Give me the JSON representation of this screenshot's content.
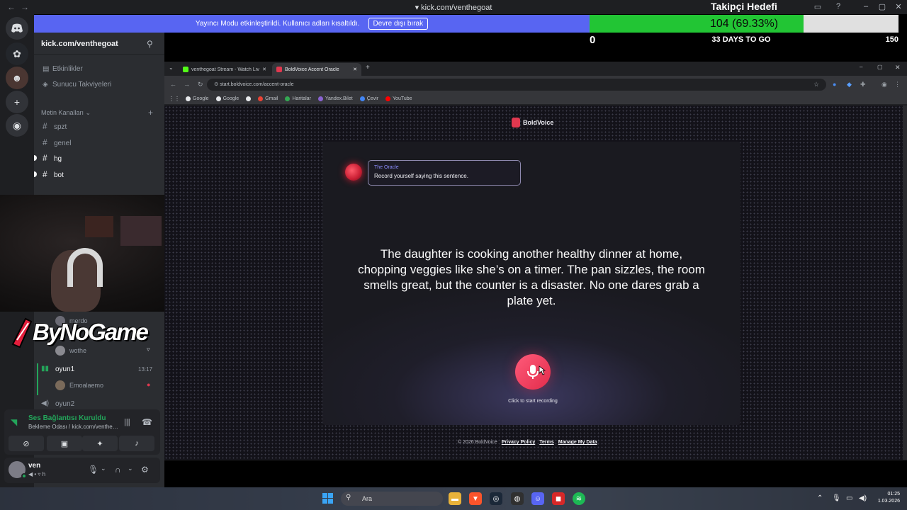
{
  "discord": {
    "window_url": "kick.com/venthegoat",
    "streamer_banner": {
      "text": "Yayıncı Modu etkinleştirildi. Kullanıcı adları kısaltıldı.",
      "button": "Devre dışı bırak"
    },
    "server_name": "kick.com/venthegoat",
    "sidebar_links": [
      {
        "label": "Etkinlikler",
        "icon": "calendar-icon"
      },
      {
        "label": "Sunucu Takviyeleri",
        "icon": "boost-icon"
      }
    ],
    "category_label": "Metin Kanalları",
    "text_channels": [
      "spzt",
      "genel",
      "hg",
      "bot"
    ],
    "voice": {
      "members": [
        "merdo",
        "wothe"
      ],
      "channel1": {
        "name": "oyun1",
        "time": "13:17",
        "member": "Emoalaemo"
      },
      "channel2": {
        "name": "oyun2"
      }
    },
    "voice_panel": {
      "status": "Ses Bağlantısı Kuruldu",
      "sub": "Bekleme Odası / kick.com/venthegoat"
    },
    "user": {
      "name": "ven",
      "sub": "h"
    }
  },
  "overlay": {
    "logo_text": "ByNoGame",
    "goal": {
      "title": "Takipçi Hedefi",
      "count": "104 (69.33%)",
      "progress": 0.6933,
      "min": "0",
      "max": "150",
      "days": "33 DAYS TO GO"
    }
  },
  "browser": {
    "tabs": [
      {
        "title": "venthegoat Stream - Watch Live",
        "color": "#53fc18",
        "active": false
      },
      {
        "title": "BoldVoice Accent Oracle",
        "color": "#e0384f",
        "active": true
      }
    ],
    "url": "start.boldvoice.com/accent-oracle",
    "bookmarks": [
      "Google",
      "Google",
      "",
      "Gmail",
      "Haritalar",
      "Yandex.Bilet",
      "Çevir",
      "YouTube"
    ]
  },
  "boldvoice": {
    "brand": "BoldVoice",
    "oracle_name": "The Oracle",
    "oracle_message": "Record yourself saying this sentence.",
    "sentence": "The daughter is cooking another healthy dinner at home, chopping veggies like she’s on a timer. The pan sizzles, the room smells great, but the counter is a disaster. No one dares grab a plate yet.",
    "record_label": "Click to start recording",
    "footer": {
      "copyright": "© 2026 BoldVoice",
      "links": [
        "Privacy Policy",
        "Terms",
        "Manage My Data"
      ]
    }
  },
  "taskbar": {
    "search_placeholder": "Ara",
    "time": "01:25",
    "date": "1.03.2026"
  }
}
